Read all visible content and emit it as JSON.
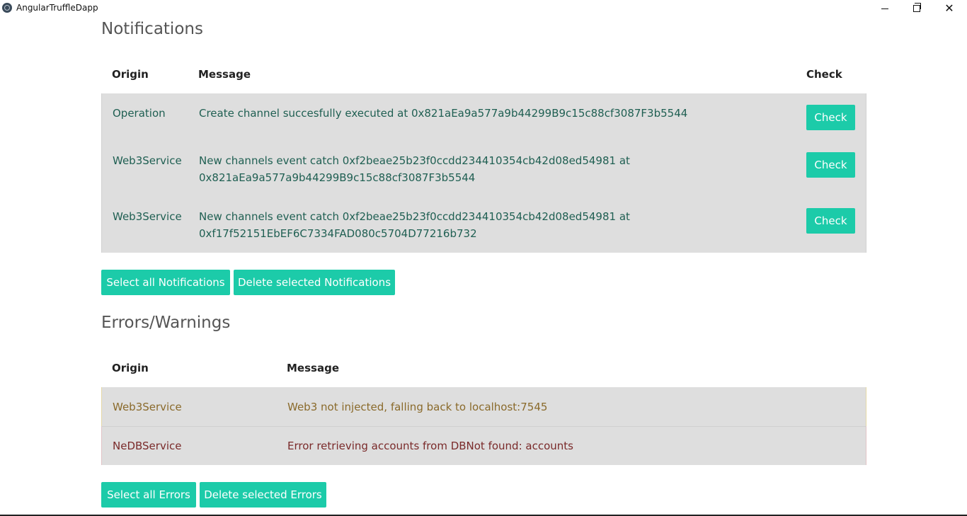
{
  "window": {
    "title": "AngularTruffleDapp",
    "minimize_icon": "minimize-icon",
    "maximize_icon": "restore-icon",
    "close_icon": "close-icon",
    "close_glyph": "✕"
  },
  "notifications": {
    "title": "Notifications",
    "headers": {
      "origin": "Origin",
      "message": "Message",
      "check": "Check"
    },
    "rows": [
      {
        "origin": "Operation",
        "message_line1": "Create channel succesfully executed at 0x821aEa9a577a9b44299B9c15c88cf3087F3b5544",
        "message_line2": "",
        "check_label": "Check"
      },
      {
        "origin": "Web3Service",
        "message_line1": "New channels event catch 0xf2beae25b23f0ccdd234410354cb42d08ed54981 at",
        "message_line2": "0x821aEa9a577a9b44299B9c15c88cf3087F3b5544",
        "check_label": "Check"
      },
      {
        "origin": "Web3Service",
        "message_line1": "New channels event catch 0xf2beae25b23f0ccdd234410354cb42d08ed54981 at",
        "message_line2": "0xf17f52151EbEF6C7334FAD080c5704D77216b732",
        "check_label": "Check"
      }
    ],
    "select_all_label": "Select all Notifications",
    "delete_selected_label": "Delete selected Notifications"
  },
  "errors": {
    "title": "Errors/Warnings",
    "headers": {
      "origin": "Origin",
      "message": "Message"
    },
    "rows": [
      {
        "origin": "Web3Service",
        "message": "Web3 not injected, falling back to localhost:7545",
        "level": "warning"
      },
      {
        "origin": "NeDBService",
        "message": "Error retrieving accounts from DBNot found: accounts",
        "level": "error"
      }
    ],
    "select_all_label": "Select all Errors",
    "delete_selected_label": "Delete selected Errors"
  },
  "colors": {
    "accent": "#1ccba9",
    "row_background": "#dedede",
    "notification_text": "#1f5f52",
    "warning_text": "#8a6a2b",
    "error_text": "#7a2a2a"
  }
}
